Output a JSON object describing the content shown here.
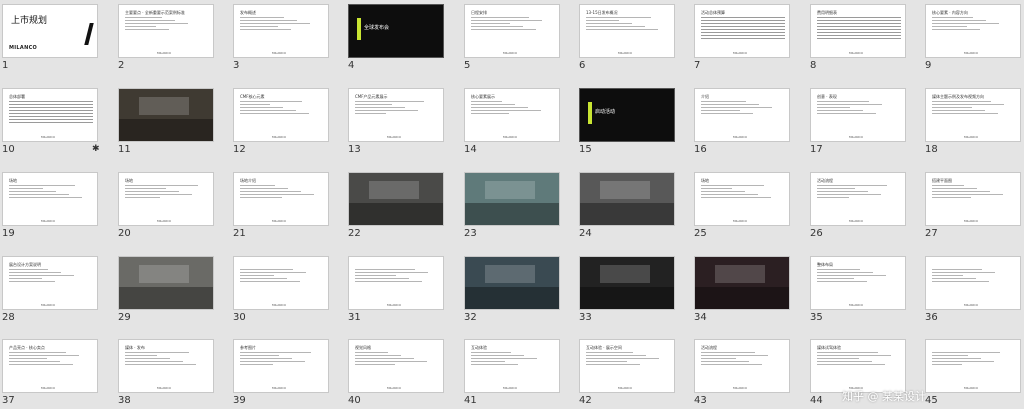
{
  "slides": [
    {
      "n": "1",
      "type": "cover",
      "title": "上市规划",
      "logo": "MILANCO"
    },
    {
      "n": "2",
      "type": "text",
      "title": "主要要点 · 全新重要示范案例标准"
    },
    {
      "n": "3",
      "type": "text",
      "title": "发布概述"
    },
    {
      "n": "4",
      "type": "dark",
      "title": "全球发布会"
    },
    {
      "n": "5",
      "type": "text",
      "title": "日程安排"
    },
    {
      "n": "6",
      "type": "text",
      "title": "13-15日发布概况"
    },
    {
      "n": "7",
      "type": "table",
      "title": "活动总体预算"
    },
    {
      "n": "8",
      "type": "table",
      "title": "费用明细表"
    },
    {
      "n": "9",
      "type": "text",
      "title": "核心要素 · 内容方向"
    },
    {
      "n": "10",
      "type": "table",
      "title": "总体部署",
      "star": "✱"
    },
    {
      "n": "11",
      "type": "photo",
      "title": ""
    },
    {
      "n": "12",
      "type": "text",
      "title": "CMF核心元素"
    },
    {
      "n": "13",
      "type": "text",
      "title": "CMF产品元素展示"
    },
    {
      "n": "14",
      "type": "text",
      "title": "核心要素展示"
    },
    {
      "n": "15",
      "type": "dark",
      "title": "启动活动"
    },
    {
      "n": "16",
      "type": "text",
      "title": "介绍"
    },
    {
      "n": "17",
      "type": "text",
      "title": "创意 · 表现"
    },
    {
      "n": "18",
      "type": "text",
      "title": "媒体主题示例及发布视频方向"
    },
    {
      "n": "19",
      "type": "text",
      "title": "场地"
    },
    {
      "n": "20",
      "type": "text",
      "title": "场地"
    },
    {
      "n": "21",
      "type": "text",
      "title": "场地介绍"
    },
    {
      "n": "22",
      "type": "photo",
      "title": ""
    },
    {
      "n": "23",
      "type": "photo",
      "title": ""
    },
    {
      "n": "24",
      "type": "photo",
      "title": ""
    },
    {
      "n": "25",
      "type": "text",
      "title": "场地"
    },
    {
      "n": "26",
      "type": "text",
      "title": "活动流程"
    },
    {
      "n": "27",
      "type": "text",
      "title": "搭建平面图"
    },
    {
      "n": "28",
      "type": "text",
      "title": "展台设计方案说明"
    },
    {
      "n": "29",
      "type": "photo",
      "title": ""
    },
    {
      "n": "30",
      "type": "text",
      "title": ""
    },
    {
      "n": "31",
      "type": "text",
      "title": ""
    },
    {
      "n": "32",
      "type": "photo",
      "title": ""
    },
    {
      "n": "33",
      "type": "photo",
      "title": ""
    },
    {
      "n": "34",
      "type": "photo",
      "title": ""
    },
    {
      "n": "35",
      "type": "text",
      "title": "整体布局"
    },
    {
      "n": "36",
      "type": "text",
      "title": ""
    },
    {
      "n": "37",
      "type": "text",
      "title": "产品亮点 · 核心卖点"
    },
    {
      "n": "38",
      "type": "text",
      "title": "媒体 · 发布"
    },
    {
      "n": "39",
      "type": "text",
      "title": "参考图片"
    },
    {
      "n": "40",
      "type": "text",
      "title": "视觉风格"
    },
    {
      "n": "41",
      "type": "text",
      "title": "互动体验"
    },
    {
      "n": "42",
      "type": "text",
      "title": "互动体验 · 展示空间"
    },
    {
      "n": "43",
      "type": "text",
      "title": "活动流程"
    },
    {
      "n": "44",
      "type": "text",
      "title": "媒体试驾体验"
    },
    {
      "n": "45",
      "type": "text",
      "title": ""
    }
  ],
  "footer_logo": "MILANCO",
  "watermark": "知乎 @ 某某设计"
}
